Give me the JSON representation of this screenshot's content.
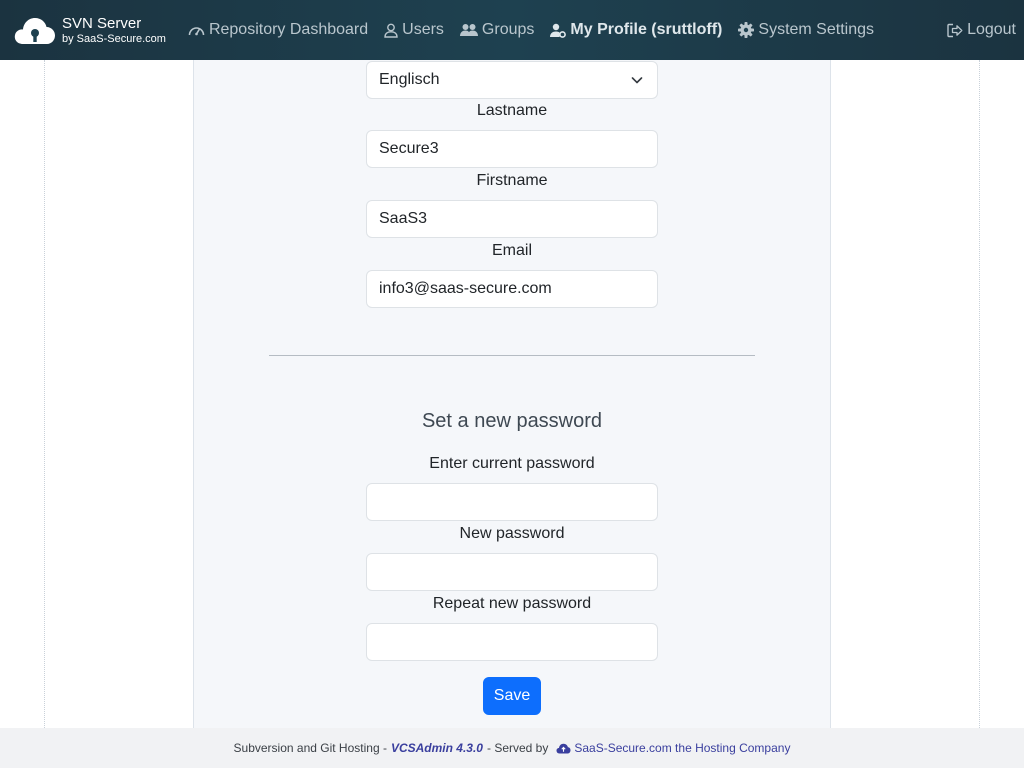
{
  "brand": {
    "title": "SVN Server",
    "subtitle": "by SaaS-Secure.com"
  },
  "nav": {
    "items": [
      {
        "label": "Repository Dashboard",
        "icon": "dashboard-icon"
      },
      {
        "label": "Users",
        "icon": "user-icon"
      },
      {
        "label": "Groups",
        "icon": "users-group-icon"
      },
      {
        "label": "My Profile (sruttloff)",
        "icon": "user-gear-icon",
        "active": true
      },
      {
        "label": "System Settings",
        "icon": "gear-icon"
      }
    ],
    "logout": {
      "label": "Logout",
      "icon": "logout-icon"
    }
  },
  "profile_form": {
    "language_value": "Englisch",
    "lastname_label": "Lastname",
    "lastname_value": "Secure3",
    "firstname_label": "Firstname",
    "firstname_value": "SaaS3",
    "email_label": "Email",
    "email_value": "info3@saas-secure.com"
  },
  "password_form": {
    "title": "Set a new password",
    "current_label": "Enter current password",
    "current_value": "",
    "new_label": "New password",
    "new_value": "",
    "repeat_label": "Repeat new password",
    "repeat_value": "",
    "save_label": "Save"
  },
  "footer": {
    "prefix": "Subversion and Git Hosting -",
    "product": "VCSAdmin 4.3.0",
    "served_by": "- Served by",
    "host": "SaaS-Secure.com the Hosting Company"
  },
  "colors": {
    "navbar": "#1e4150",
    "primary": "#0d6efd",
    "panel_bg": "#f5f7fa",
    "footer_link": "#3a3f9e"
  }
}
